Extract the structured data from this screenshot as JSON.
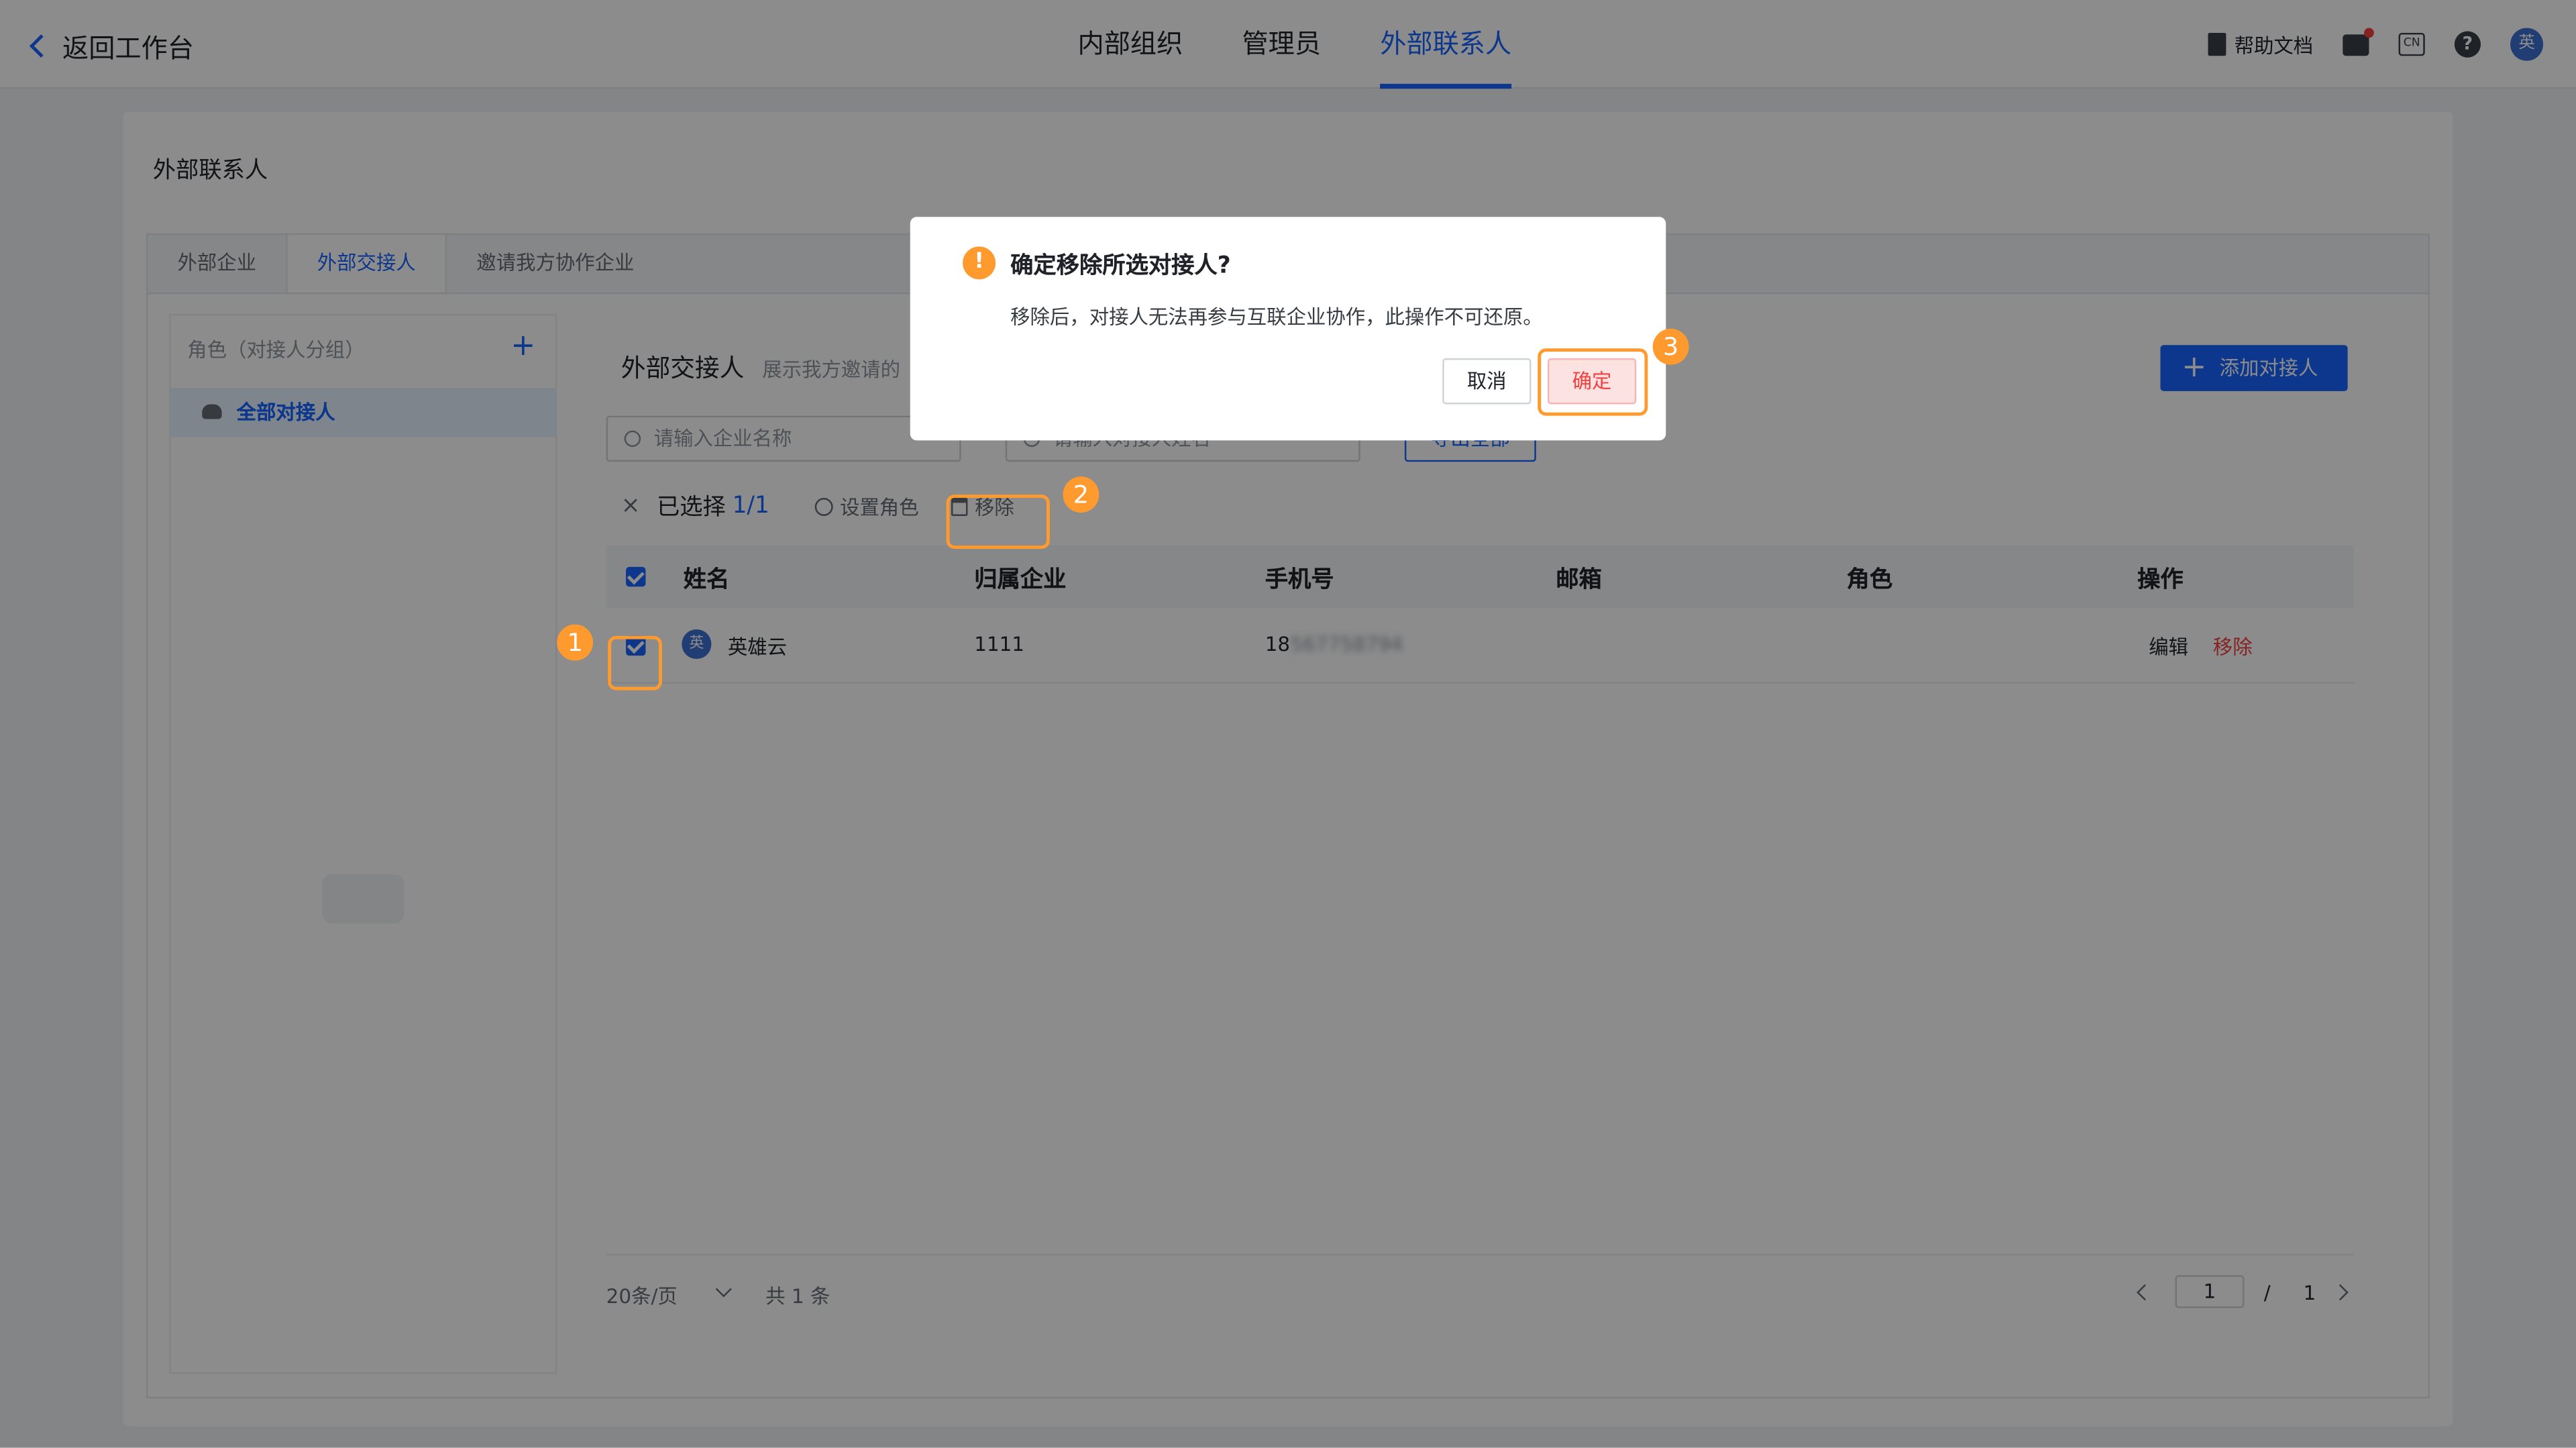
{
  "topbar": {
    "back_label": "返回工作台",
    "tabs": [
      "内部组织",
      "管理员",
      "外部联系人"
    ],
    "active_tab": 2,
    "help_label": "帮助文档",
    "lang_label": "CN",
    "help_icon_label": "?",
    "avatar_label": "英"
  },
  "card": {
    "title": "外部联系人",
    "tabs": [
      "外部企业",
      "外部交接人",
      "邀请我方协作企业"
    ],
    "active_tab": 1
  },
  "left_panel": {
    "header": "角色（对接人分组）",
    "add_icon": "+",
    "item_label": "全部对接人"
  },
  "main": {
    "title": "外部交接人",
    "subtitle": "展示我方邀请的",
    "add_button": "添加对接人",
    "search_company_placeholder": "请输入企业名称",
    "search_contact_placeholder": "请输入对接人姓名",
    "export_button": "导出全部"
  },
  "selection_bar": {
    "close_icon": "×",
    "label": "已选择",
    "count": "1/1",
    "set_role": "设置角色",
    "remove": "移除"
  },
  "table": {
    "columns": [
      "姓名",
      "归属企业",
      "手机号",
      "邮箱",
      "角色",
      "操作"
    ],
    "rows": [
      {
        "avatar": "英",
        "name": "英雄云",
        "company": "1111",
        "phone_prefix": "18",
        "phone_masked": "567758794",
        "email": "",
        "role": "",
        "edit": "编辑",
        "remove": "移除"
      }
    ]
  },
  "pager": {
    "page_size": "20条/页",
    "total": "共 1 条",
    "current": "1",
    "sep": "/",
    "pages": "1"
  },
  "modal": {
    "warning_icon": "!",
    "title": "确定移除所选对接人?",
    "body": "移除后，对接人无法再参与互联企业协作，此操作不可还原。",
    "cancel": "取消",
    "ok": "确定"
  },
  "annotations": [
    "1",
    "2",
    "3"
  ],
  "colors": {
    "primary": "#1664ff",
    "danger": "#f53f3f",
    "annotation": "#ff9a2e"
  }
}
